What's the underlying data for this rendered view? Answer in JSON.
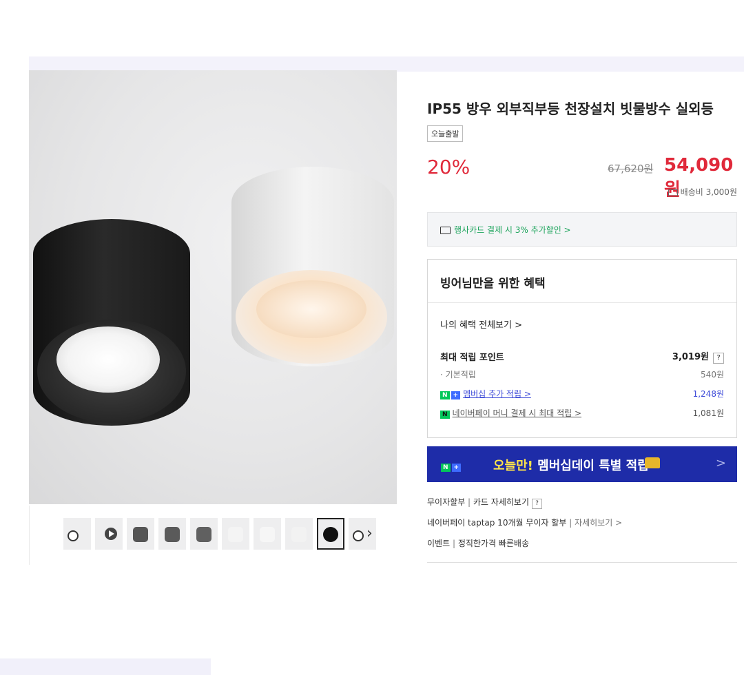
{
  "product": {
    "title": "IP55 방우 외부직부등 천장설치 빗물방수 실외등",
    "tag": "오늘출발",
    "discount": "20%",
    "original_price": "67,620원",
    "sale_price": "54,090원",
    "shipping": "배송비 3,000원"
  },
  "card_promo": "행사카드 결제 시 3% 추가할인 >",
  "benefits": {
    "heading": "빙어님만을 위한 혜택",
    "my_benefits_link": "나의 혜택 전체보기 >",
    "max_points_label": "최대 적립 포인트",
    "max_points_value": "3,019원",
    "help_mark": "?",
    "basic_label": "· 기본적립",
    "basic_value": "540원",
    "membership_label": "멤버십 추가 적립 >",
    "membership_value": "1,248원",
    "npay_label": "네이버페이 머니 결제 시 최대 적립 >",
    "npay_value": "1,081원"
  },
  "banner": {
    "text_prefix": "오늘만!",
    "text_highlight": " 멤버십데이 특별 적립",
    "chevron": ">"
  },
  "payment_info": {
    "installment_label": "무이자할부",
    "card_details": "카드 자세히보기",
    "help_mark": "?",
    "npay_installment": "네이버페이 taptap 10개월 무이자 할부",
    "npay_details": "자세히보기 >",
    "event_label": "이벤트",
    "event_text": "정직한가격 빠른배송"
  },
  "gallery": {
    "next_arrow": "›",
    "thumbnails": [
      "lamp-pair",
      "video",
      "dark-lamp",
      "dark-lamp",
      "dark-lamp",
      "white-lamp",
      "white-lamp",
      "white-lamp",
      "black-lamp-selected",
      "lamp-pair"
    ],
    "selected_index": 8
  },
  "colors": {
    "sale_red": "#e0293a",
    "naver_green": "#03c75a",
    "banner_blue": "#1e2ca8",
    "link_blue": "#3e4bd8"
  }
}
